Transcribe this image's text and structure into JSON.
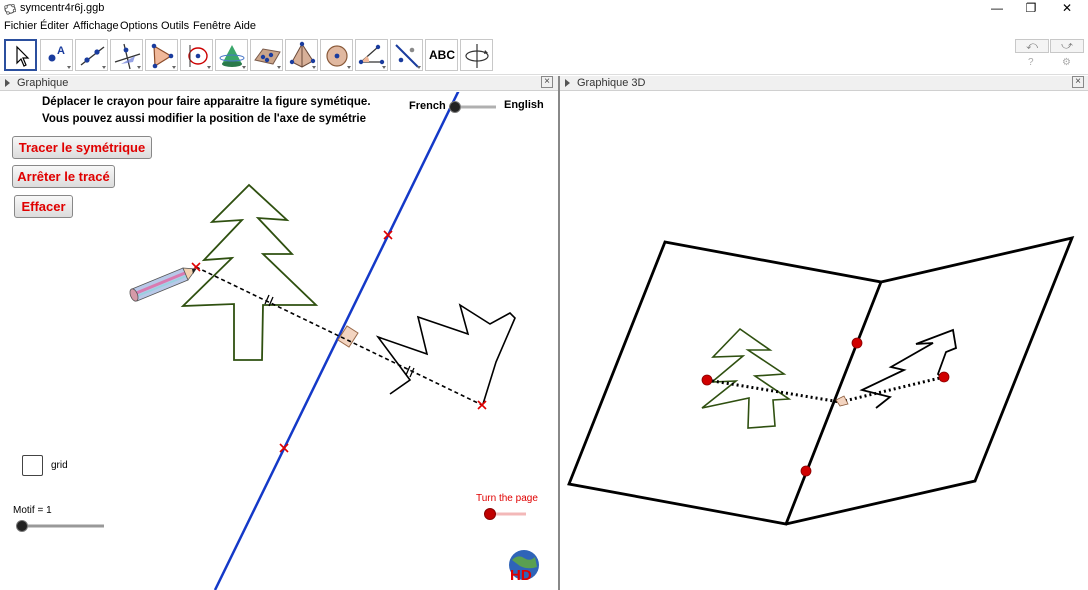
{
  "window": {
    "title": "symcentr4r6j.ggb",
    "controls": {
      "minimize": "—",
      "restore": "❐",
      "close": "✕"
    }
  },
  "menu": [
    "Fichier",
    "Éditer",
    "Affichage",
    "Options",
    "Outils",
    "Fenêtre",
    "Aide"
  ],
  "toolbar": {
    "tools": [
      "move-tool",
      "point-tool",
      "line-tool",
      "perpendicular-tool",
      "polygon-tool",
      "circle-tool",
      "intersect-tool",
      "sphere-tool",
      "plane-tool",
      "pyramid-tool",
      "net-tool",
      "angle-tool",
      "reflect-tool",
      "text-tool",
      "rotate-view-tool"
    ],
    "text_tool_label": "ABC",
    "undo": "⤺",
    "redo": "⤻",
    "help": "?",
    "settings": "⚙"
  },
  "graphics_panel": {
    "title": "Graphique",
    "instructions": [
      "Déplacer le crayon pour faire apparaitre la figure symétique.",
      "Vous pouvez aussi modifier la position de l'axe de symétrie"
    ],
    "language_left": "French",
    "language_right": "English",
    "buttons": {
      "trace": "Tracer le symétrique",
      "stop": "Arrêter le tracé",
      "clear": "Effacer"
    },
    "grid_label": "grid",
    "motif_label": "Motif = 1",
    "turn_page_label": "Turn the page",
    "logo_text": "HD",
    "colors": {
      "axis": "#1439c8",
      "tree": "#2f5010",
      "button_text": "#e00000",
      "marker": "#e00000"
    }
  },
  "graphics_3d_panel": {
    "title": "Graphique 3D"
  }
}
